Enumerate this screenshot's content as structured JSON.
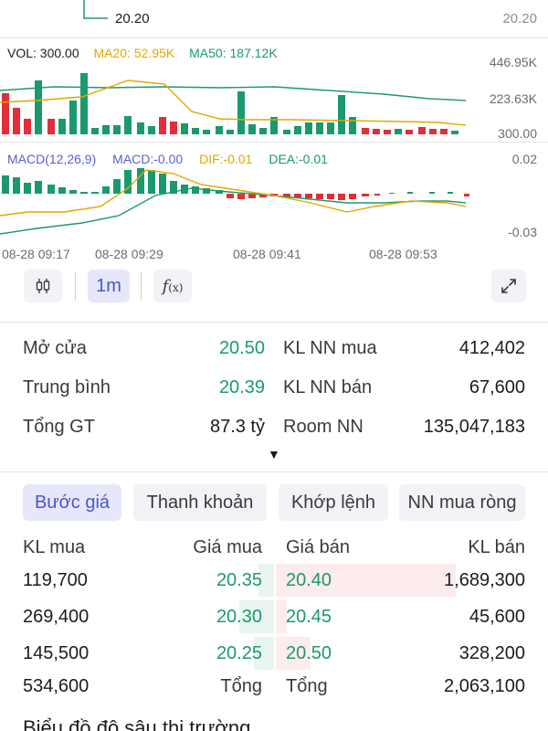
{
  "price_axis": {
    "left_label": "20.20",
    "right_label": "20.20"
  },
  "volume": {
    "vol_label": "VOL: 300.00",
    "ma20_label": "MA20: 52.95K",
    "ma50_label": "MA50: 187.12K",
    "axis_top": "446.95K",
    "axis_mid": "223.63K",
    "axis_bottom": "300.00",
    "colors": {
      "ma20": "#e0a800",
      "ma50": "#1a9a6c",
      "up": "#1a9a6c",
      "down": "#e02e3b"
    }
  },
  "macd": {
    "title": "MACD(12,26,9)",
    "macd_label": "MACD:-0.00",
    "dif_label": "DIF:-0.01",
    "dea_label": "DEA:-0.01",
    "axis_top": "0.02",
    "axis_bottom": "-0.03",
    "colors": {
      "macd": "#5a5fd0",
      "dif": "#e0a800",
      "dea": "#1a9a6c"
    }
  },
  "time_labels": [
    "08-28 09:17",
    "08-28 09:29",
    "08-28 09:41",
    "08-28 09:53"
  ],
  "toolbar": {
    "candle_icon": "candlestick-icon",
    "interval_label": "1m",
    "indicator_icon": "function-icon",
    "expand_icon": "expand-icon"
  },
  "stats": {
    "open_label": "Mở cửa",
    "open_value": "20.50",
    "avg_label": "Trung bình",
    "avg_value": "20.39",
    "total_label": "Tổng GT",
    "total_value": "87.3 tỷ",
    "foreign_buy_label": "KL NN mua",
    "foreign_buy_value": "412,402",
    "foreign_sell_label": "KL NN bán",
    "foreign_sell_value": "67,600",
    "room_label": "Room NN",
    "room_value": "135,047,183",
    "expand_caret": "▼"
  },
  "tabs": [
    "Bước giá",
    "Thanh khoản",
    "Khớp lệnh",
    "NN mua ròng"
  ],
  "orderbook": {
    "headers": {
      "buy_vol": "KL mua",
      "buy_price": "Giá mua",
      "sell_price": "Giá bán",
      "sell_vol": "KL bán"
    },
    "rows": [
      {
        "buy_vol": "119,700",
        "buy_price": "20.35",
        "sell_price": "20.40",
        "sell_vol": "1,689,300",
        "buy_share": 0.07,
        "sell_share": 0.82
      },
      {
        "buy_vol": "269,400",
        "buy_price": "20.30",
        "sell_price": "20.45",
        "sell_vol": "45,600",
        "buy_share": 0.16,
        "sell_share": 0.02
      },
      {
        "buy_vol": "145,500",
        "buy_price": "20.25",
        "sell_price": "20.50",
        "sell_vol": "328,200",
        "buy_share": 0.09,
        "sell_share": 0.16
      }
    ],
    "total": {
      "buy_vol": "534,600",
      "buy_label": "Tổng",
      "sell_label": "Tổng",
      "sell_vol": "2,063,100"
    }
  },
  "depth_title": "Biểu đồ độ sâu thị trường"
}
